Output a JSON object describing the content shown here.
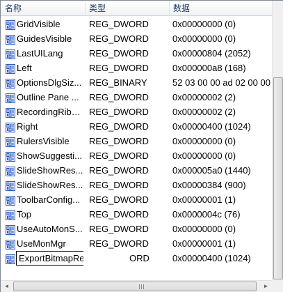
{
  "columns": {
    "name": "名称",
    "type": "类型",
    "data": "数据"
  },
  "rows": [
    {
      "name": "GridVisible",
      "type": "REG_DWORD",
      "data": "0x00000000 (0)"
    },
    {
      "name": "GuidesVisible",
      "type": "REG_DWORD",
      "data": "0x00000000 (0)"
    },
    {
      "name": "LastUILang",
      "type": "REG_DWORD",
      "data": "0x00000804 (2052)"
    },
    {
      "name": "Left",
      "type": "REG_DWORD",
      "data": "0x000000a8 (168)"
    },
    {
      "name": "OptionsDlgSiz...",
      "type": "REG_BINARY",
      "data": "52 03 00 00 ad 02 00 00"
    },
    {
      "name": "Outline Pane ...",
      "type": "REG_DWORD",
      "data": "0x00000002 (2)"
    },
    {
      "name": "RecordingRibb...",
      "type": "REG_DWORD",
      "data": "0x00000002 (2)"
    },
    {
      "name": "Right",
      "type": "REG_DWORD",
      "data": "0x00000400 (1024)"
    },
    {
      "name": "RulersVisible",
      "type": "REG_DWORD",
      "data": "0x00000000 (0)"
    },
    {
      "name": "ShowSuggesti...",
      "type": "REG_DWORD",
      "data": "0x00000000 (0)"
    },
    {
      "name": "SlideShowRes...",
      "type": "REG_DWORD",
      "data": "0x000005a0 (1440)"
    },
    {
      "name": "SlideShowRes...",
      "type": "REG_DWORD",
      "data": "0x00000384 (900)"
    },
    {
      "name": "ToolbarConfig...",
      "type": "REG_DWORD",
      "data": "0x00000001 (1)"
    },
    {
      "name": "Top",
      "type": "REG_DWORD",
      "data": "0x0000004c (76)"
    },
    {
      "name": "UseAutoMonS...",
      "type": "REG_DWORD",
      "data": "0x00000000 (0)"
    },
    {
      "name": "UseMonMgr",
      "type": "REG_DWORD",
      "data": "0x00000001 (1)"
    },
    {
      "name": "",
      "type": "ORD",
      "data": "0x00000400 (1024)",
      "editing_value": "ExportBitmapResolution"
    }
  ],
  "icons": {
    "value": "registry-dword-icon",
    "colors": {
      "border": "#2f5fbf",
      "bits": "#1a48b8",
      "bg": "#e8eefc"
    }
  },
  "scrollbars": {
    "left_arrow": "◄",
    "right_arrow": "►"
  }
}
